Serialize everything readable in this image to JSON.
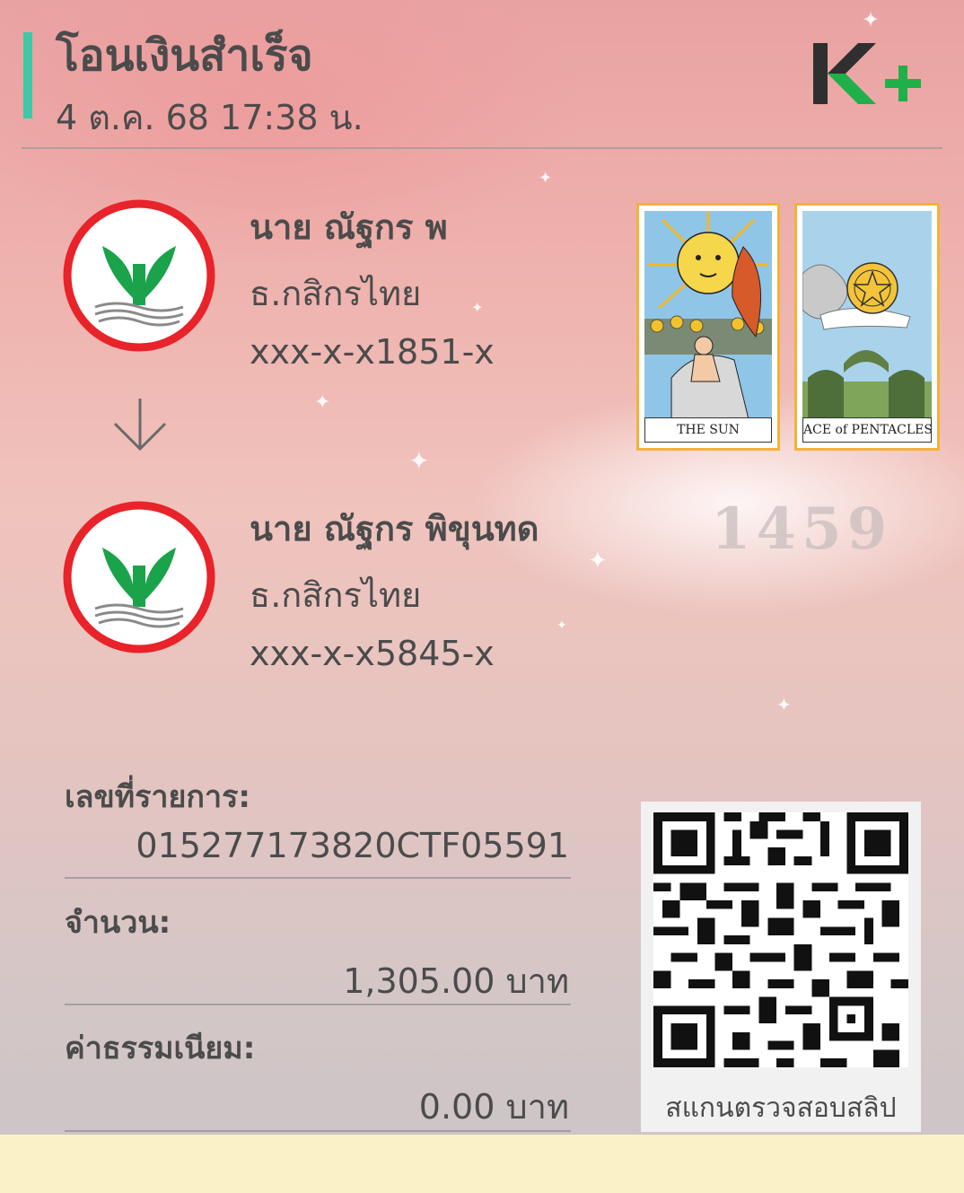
{
  "header": {
    "title": "โอนเงินสำเร็จ",
    "datetime": "4 ต.ค. 68  17:38 น.",
    "accent_color": "#3fc8a5",
    "logo_icon": "kplus-logo-icon"
  },
  "sender": {
    "name": "นาย ณัฐกร พ",
    "bank": "ธ.กสิกรไทย",
    "account": "xxx-x-x1851-x",
    "bank_icon": "kasikorn-bank-logo-icon"
  },
  "receiver": {
    "name": "นาย ณัฐกร พิขุนทด",
    "bank": "ธ.กสิกรไทย",
    "account": "xxx-x-x5845-x",
    "bank_icon": "kasikorn-bank-logo-icon"
  },
  "decoration": {
    "card1_label": "THE SUN",
    "card2_label": "ACE of PENTACLES",
    "watermark": "1459"
  },
  "details": {
    "ref_label": "เลขที่รายการ:",
    "ref_value": "015277173820CTF05591",
    "amount_label": "จำนวน:",
    "amount_value": "1,305.00 บาท",
    "fee_label": "ค่าธรรมเนียม:",
    "fee_value": "0.00 บาท"
  },
  "qr": {
    "caption": "สแกนตรวจสอบสลิป"
  },
  "colors": {
    "kasikorn_green": "#1aa34a",
    "kasikorn_red": "#e8232a",
    "bottom_bar": "#fbf1c6"
  }
}
